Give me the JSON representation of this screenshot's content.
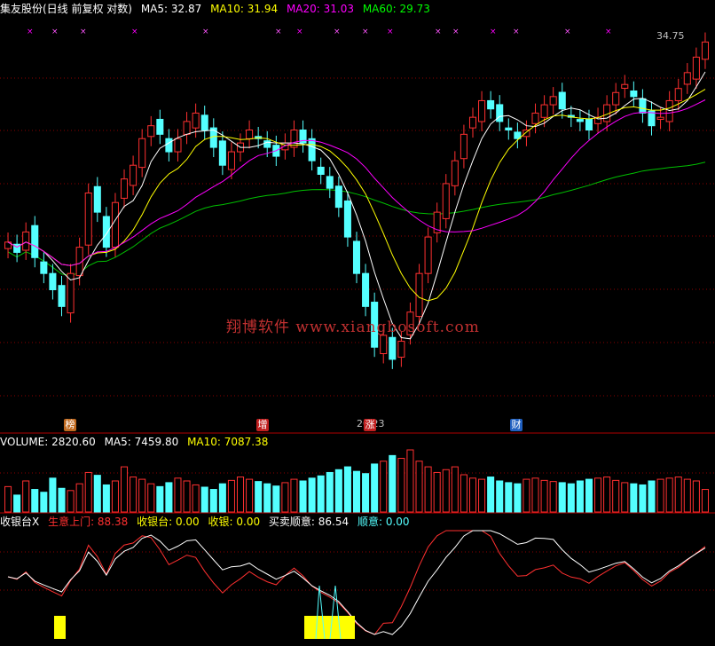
{
  "header": {
    "stock": "集友股份(日线 前复权 对数)",
    "ma5_label": "MA5: 32.87",
    "ma10_label": "MA10: 31.94",
    "ma20_label": "MA20: 31.03",
    "ma60_label": "MA60: 29.73"
  },
  "volume_header": {
    "volume_label": "VOLUME: 2820.60",
    "ma5_label": "MA5: 7459.80",
    "ma10_label": "MA10: 7087.38"
  },
  "indicator_header": {
    "name": "收银台X",
    "item1": "生意上门: 88.38",
    "item2": "收银台: 0.00",
    "item3": "收银: 0.00",
    "item4": "买卖顺意: 86.54",
    "item5": "顺意: 0.00"
  },
  "price_high_label": "34.75",
  "price_low_label": "20.23",
  "watermark": "翔博软件 www.xiangbosoft.com",
  "tags": [
    {
      "text": "榜",
      "color": "#c06a20"
    },
    {
      "text": "增",
      "color": "#c02020"
    },
    {
      "text": "涨",
      "color": "#c02020"
    },
    {
      "text": "财",
      "color": "#2060c0"
    }
  ],
  "colors": {
    "up": "#ff3030",
    "down": "#54ffff",
    "ma5": "#ffffff",
    "ma10": "#ffff00",
    "ma20": "#ff00ff",
    "ma60": "#00c000",
    "grid": "#8b0000",
    "signal": "#ffff00"
  },
  "chart_data": {
    "type": "candlestick",
    "title": "集友股份(日线 前复权 对数)",
    "y_scale": "log",
    "ylim": [
      20.23,
      34.75
    ],
    "annotations": [
      {
        "text": "34.75",
        "kind": "period-high"
      },
      {
        "text": "20.23",
        "kind": "period-low"
      }
    ],
    "close_series": [
      25.2,
      24.8,
      25.6,
      24.6,
      24.0,
      23.4,
      22.8,
      24.0,
      25.0,
      27.2,
      26.4,
      25.0,
      26.8,
      27.8,
      28.4,
      29.6,
      30.2,
      29.8,
      29.0,
      29.6,
      30.4,
      30.8,
      30.0,
      29.2,
      28.4,
      29.0,
      29.4,
      30.0,
      29.6,
      29.2,
      28.8,
      29.4,
      30.0,
      29.4,
      28.6,
      28.0,
      27.4,
      26.6,
      25.4,
      24.0,
      22.8,
      21.4,
      21.8,
      21.0,
      21.6,
      22.6,
      24.0,
      25.4,
      26.4,
      27.6,
      28.6,
      29.8,
      30.6,
      31.4,
      31.0,
      30.4,
      30.0,
      29.6,
      30.0,
      30.8,
      31.2,
      31.6,
      31.0,
      30.6,
      30.4,
      30.0,
      30.6,
      31.2,
      31.8,
      32.2,
      31.6,
      30.8,
      30.2,
      30.6,
      31.4,
      32.0,
      32.8,
      33.6,
      34.4
    ],
    "series": [
      {
        "name": "MA5",
        "last": 32.87
      },
      {
        "name": "MA10",
        "last": 31.94
      },
      {
        "name": "MA20",
        "last": 31.03
      },
      {
        "name": "MA60",
        "last": 29.73
      }
    ],
    "volume": {
      "last": 2820.6,
      "ma5_last": 7459.8,
      "ma10_last": 7087.38,
      "values": [
        45,
        30,
        55,
        40,
        35,
        60,
        42,
        38,
        50,
        70,
        65,
        48,
        55,
        80,
        62,
        58,
        50,
        45,
        52,
        60,
        55,
        48,
        44,
        40,
        50,
        56,
        62,
        58,
        54,
        50,
        46,
        52,
        58,
        55,
        60,
        64,
        70,
        75,
        80,
        72,
        68,
        85,
        90,
        100,
        95,
        110,
        90,
        80,
        70,
        75,
        80,
        66,
        60,
        58,
        62,
        55,
        52,
        50,
        58,
        60,
        56,
        54,
        52,
        50,
        55,
        58,
        60,
        62,
        56,
        52,
        50,
        48,
        55,
        58,
        60,
        62,
        58,
        55,
        40
      ]
    },
    "indicator": {
      "生意上门": 88.38,
      "收银台": 0.0,
      "收银": 0.0,
      "买卖顺意": 86.54,
      "顺意": 0.0
    }
  }
}
